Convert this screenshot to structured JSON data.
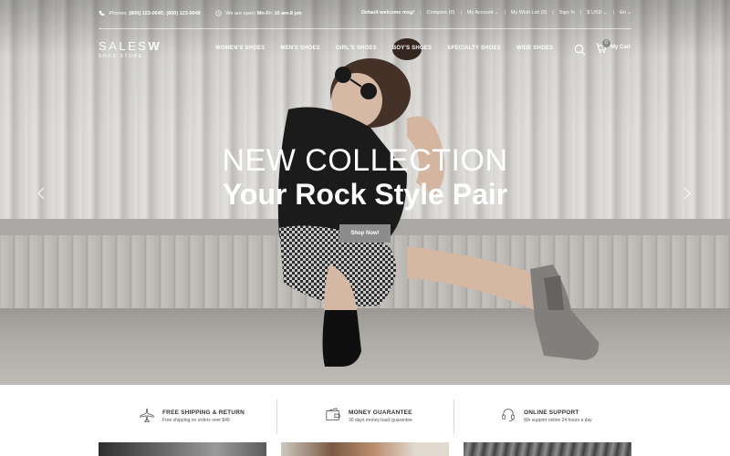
{
  "header": {
    "phone_label": "Phones:",
    "phone_numbers": "(800) 123-0045; (800) 123-0046",
    "hours_label": "We are open:",
    "hours_value": "Mn-Fr: 10 am-8 pm",
    "welcome": "Default welcome msg!",
    "compare": "Compare (0)",
    "my_account": "My Account",
    "wish_list": "My Wish List (0)",
    "sign_in": "Sign In",
    "currency": "$ USD",
    "language": "En"
  },
  "logo": {
    "main_light": "SALES",
    "main_bold": "W",
    "sub": "SHOE STORE"
  },
  "nav": {
    "items": [
      "WOMEN'S SHOES",
      "MEN'S SHOES",
      "GIRL'S SHOES",
      "BOY'S SHOES",
      "SPECIALTY SHOES",
      "WIDE SHOES"
    ]
  },
  "cart": {
    "count": "0",
    "label": "My Cart"
  },
  "hero": {
    "title": "NEW COLLECTION",
    "subtitle": "Your Rock Style Pair",
    "button": "Shop Now!"
  },
  "features": [
    {
      "title": "FREE SHIPPING & RETURN",
      "desc": "Free shipping on orders over $49",
      "icon": "airplane-icon"
    },
    {
      "title": "MONEY GUARANTEE",
      "desc": "30 days money back guarantee",
      "icon": "wallet-icon"
    },
    {
      "title": "ONLINE SUPPORT",
      "desc": "We support online 24 hours a day",
      "icon": "headset-icon"
    }
  ],
  "colors": {
    "button_bg": "#8c8c8c",
    "text_dark": "#333333",
    "white": "#ffffff"
  }
}
